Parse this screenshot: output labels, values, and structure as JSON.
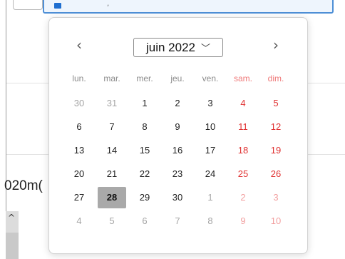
{
  "background": {
    "partial_text": "020m("
  },
  "calendar": {
    "month_label": "juin 2022",
    "prev_icon": "chevron-left-icon",
    "next_icon": "chevron-right-icon",
    "weekdays": [
      {
        "label": "lun.",
        "weekend": false
      },
      {
        "label": "mar.",
        "weekend": false
      },
      {
        "label": "mer.",
        "weekend": false
      },
      {
        "label": "jeu.",
        "weekend": false
      },
      {
        "label": "ven.",
        "weekend": false
      },
      {
        "label": "sam.",
        "weekend": true
      },
      {
        "label": "dim.",
        "weekend": true
      }
    ],
    "weeks": [
      [
        {
          "d": "30",
          "o": true
        },
        {
          "d": "31",
          "o": true
        },
        {
          "d": "1"
        },
        {
          "d": "2"
        },
        {
          "d": "3"
        },
        {
          "d": "4"
        },
        {
          "d": "5"
        }
      ],
      [
        {
          "d": "6"
        },
        {
          "d": "7"
        },
        {
          "d": "8"
        },
        {
          "d": "9"
        },
        {
          "d": "10"
        },
        {
          "d": "11"
        },
        {
          "d": "12"
        }
      ],
      [
        {
          "d": "13"
        },
        {
          "d": "14"
        },
        {
          "d": "15"
        },
        {
          "d": "16"
        },
        {
          "d": "17"
        },
        {
          "d": "18"
        },
        {
          "d": "19"
        }
      ],
      [
        {
          "d": "20"
        },
        {
          "d": "21"
        },
        {
          "d": "22"
        },
        {
          "d": "23"
        },
        {
          "d": "24"
        },
        {
          "d": "25"
        },
        {
          "d": "26"
        }
      ],
      [
        {
          "d": "27"
        },
        {
          "d": "28",
          "s": true
        },
        {
          "d": "29"
        },
        {
          "d": "30"
        },
        {
          "d": "1",
          "o": true
        },
        {
          "d": "2",
          "o": true
        },
        {
          "d": "3",
          "o": true
        }
      ],
      [
        {
          "d": "4",
          "o": true
        },
        {
          "d": "5",
          "o": true
        },
        {
          "d": "6",
          "o": true
        },
        {
          "d": "7",
          "o": true
        },
        {
          "d": "8",
          "o": true
        },
        {
          "d": "9",
          "o": true
        },
        {
          "d": "10",
          "o": true
        }
      ]
    ],
    "selected_day": "28",
    "colors": {
      "weekend": "#e03131",
      "selected_bg": "#a9a9a9",
      "accent_border": "#4e8fd6"
    }
  }
}
